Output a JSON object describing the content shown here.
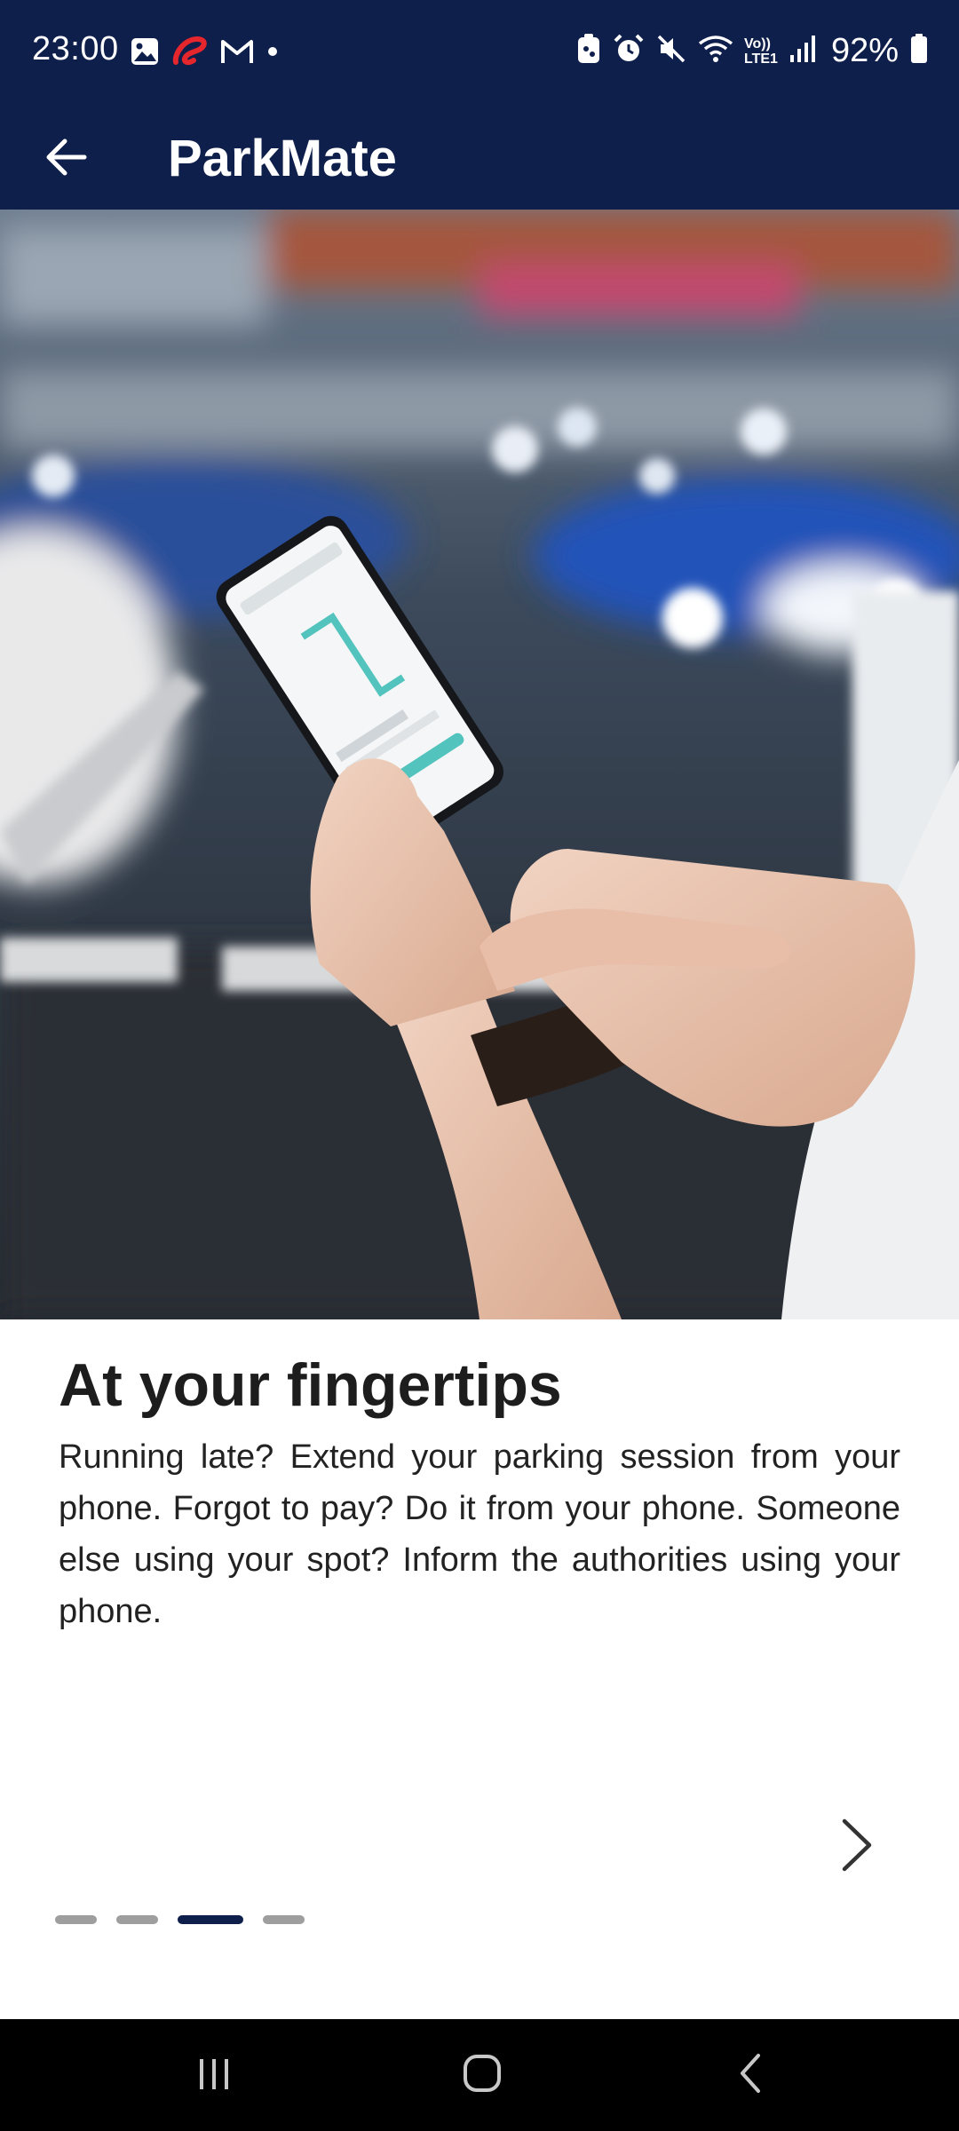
{
  "status_bar": {
    "time": "23:00",
    "battery_percent": "92%",
    "left_icons": [
      "gallery-icon",
      "airtel-icon",
      "gmail-icon",
      "dot-icon"
    ],
    "right_icons": [
      "battery-saver-icon",
      "alarm-icon",
      "mute-icon",
      "wifi-icon",
      "volte-icon",
      "signal-icon",
      "battery-icon"
    ],
    "volte_label": "Vo))",
    "lte_label": "LTE1"
  },
  "app_bar": {
    "title": "ParkMate",
    "back_icon": "back-arrow-icon"
  },
  "hero": {
    "image": "hands-holding-phone-in-parking-lot"
  },
  "onboarding": {
    "headline": "At your fingertips",
    "body": "Running late? Extend your parking session from your phone. Forgot to pay? Do it from your phone. Someone else using your spot? Inform the authorities using your phone.",
    "next_icon": "chevron-right-icon",
    "page_count": 4,
    "current_page": 3
  },
  "nav_bar": {
    "recents_icon": "recents-icon",
    "home_icon": "home-icon",
    "back_icon": "nav-back-icon"
  },
  "colors": {
    "primary": "#0f1f4b",
    "indicator_inactive": "#9e9e9e",
    "text": "#1d1d1d"
  }
}
